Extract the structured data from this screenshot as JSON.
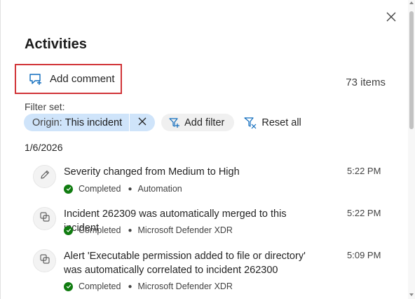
{
  "panel": {
    "title": "Activities",
    "add_comment_label": "Add comment",
    "item_count": "73 items"
  },
  "filters": {
    "label": "Filter set:",
    "chip_key": "Origin:",
    "chip_value": "This incident",
    "add_filter_label": "Add filter",
    "reset_all_label": "Reset all"
  },
  "date_group": "1/6/2026",
  "activities": [
    {
      "text": "Severity changed from Medium to High",
      "time": "5:22 PM",
      "status": "Completed",
      "source": "Automation",
      "icon": "pencil-icon"
    },
    {
      "text": "Incident 262309 was automatically merged to this incident",
      "time": "5:22 PM",
      "status": "Completed",
      "source": "Microsoft Defender XDR",
      "icon": "merge-icon"
    },
    {
      "text": "Alert 'Executable permission added to file or directory' was automatically correlated to incident 262300",
      "time": "5:09 PM",
      "status": "Completed",
      "source": "Microsoft Defender XDR",
      "icon": "merge-icon"
    }
  ],
  "colors": {
    "accent": "#0f6cbd",
    "highlight_border": "#d13438",
    "chip_bg": "#cfe4fa",
    "success": "#107c10"
  }
}
